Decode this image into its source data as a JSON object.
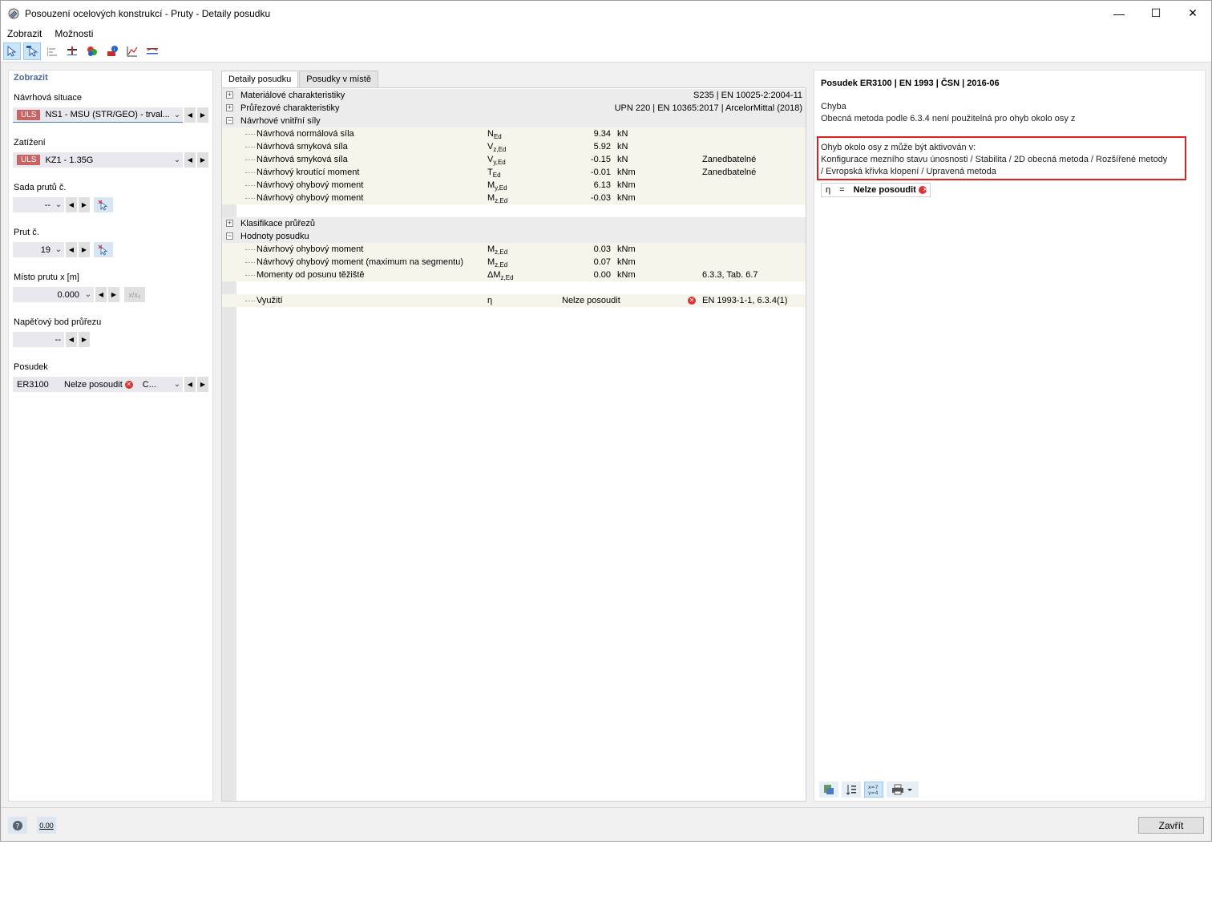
{
  "window": {
    "title": "Posouzení ocelových konstrukcí - Pruty - Detaily posudku",
    "minimize": "—",
    "maximize": "☐",
    "close": "✕"
  },
  "menu": [
    "Zobrazit",
    "Možnosti"
  ],
  "left": {
    "header": "Zobrazit",
    "design_situation_label": "Návrhová situace",
    "design_situation_tag": "ULS",
    "design_situation_value": "NS1 - MSÚ (STR/GEO) - trval...",
    "loading_label": "Zatížení",
    "loading_tag": "ULS",
    "loading_value": "KZ1 - 1.35G",
    "member_set_label": "Sada prutů č.",
    "member_set_value": "--",
    "member_label": "Prut č.",
    "member_value": "19",
    "location_label": "Místo prutu x [m]",
    "location_value": "0.000",
    "location_rel": "x/x₀",
    "stress_point_label": "Napěťový bod průřezu",
    "stress_point_value": "--",
    "check_label": "Posudek",
    "check_id": "ER3100",
    "check_status": "Nelze posoudit",
    "check_extra": "C..."
  },
  "tabs": [
    "Detaily posudku",
    "Posudky v místě"
  ],
  "sections": {
    "material": {
      "label": "Materiálové charakteristiky",
      "value": "S235 | EN 10025-2:2004-11"
    },
    "section": {
      "label": "Průřezové charakteristiky",
      "value": "UPN 220 | EN 10365:2017 | ArcelorMittal (2018)"
    },
    "forces": {
      "label": "Návrhové vnitřní síly"
    },
    "classification": {
      "label": "Klasifikace průřezů"
    },
    "check_values": {
      "label": "Hodnoty posudku"
    }
  },
  "force_rows": [
    {
      "name": "Návrhová normálová síla",
      "sym": "N",
      "sub": "Ed",
      "value": "9.34",
      "unit": "kN",
      "note": ""
    },
    {
      "name": "Návrhová smyková síla",
      "sym": "V",
      "sub": "z,Ed",
      "value": "5.92",
      "unit": "kN",
      "note": ""
    },
    {
      "name": "Návrhová smyková síla",
      "sym": "V",
      "sub": "y,Ed",
      "value": "-0.15",
      "unit": "kN",
      "note": "Zanedbatelné"
    },
    {
      "name": "Návrhový kroutící moment",
      "sym": "T",
      "sub": "Ed",
      "value": "-0.01",
      "unit": "kNm",
      "note": "Zanedbatelné"
    },
    {
      "name": "Návrhový ohybový moment",
      "sym": "M",
      "sub": "y,Ed",
      "value": "6.13",
      "unit": "kNm",
      "note": ""
    },
    {
      "name": "Návrhový ohybový moment",
      "sym": "M",
      "sub": "z,Ed",
      "value": "-0.03",
      "unit": "kNm",
      "note": ""
    }
  ],
  "check_rows": [
    {
      "name": "Návrhový ohybový moment",
      "sym": "M",
      "sub": "z,Ed",
      "value": "0.03",
      "unit": "kNm",
      "note": ""
    },
    {
      "name": "Návrhový ohybový moment (maximum na segmentu)",
      "sym": "M",
      "sub": "z,Ed",
      "value": "0.07",
      "unit": "kNm",
      "note": ""
    },
    {
      "name": "Momenty od posunu těžiště",
      "sym": "ΔM",
      "sub": "z,Ed",
      "value": "0.00",
      "unit": "kNm",
      "note": "6.3.3, Tab. 6.7"
    }
  ],
  "utilization": {
    "name": "Využití",
    "sym": "η",
    "value": "Nelze posoudit",
    "note": "EN 1993-1-1, 6.3.4(1)"
  },
  "right": {
    "title": "Posudek ER3100 | EN 1993 | ČSN | 2016-06",
    "error_label": "Chyba",
    "error_text": "Obecná metoda podle 6.3.4 není použitelná pro ohyb okolo osy z",
    "hint_line1": "Ohyb okolo osy z může být aktivován v:",
    "hint_line2": "Konfigurace mezního stavu únosnosti / Stabilita / 2D obecná metoda / Rozšířené metody",
    "hint_line3": "/ Evropská křivka klopení / Upravená metoda",
    "result_sym": "η",
    "result_eq": "=",
    "result_value": "Nelze posoudit"
  },
  "footer": {
    "close_label": "Zavřít",
    "units_label": "0.00"
  },
  "colors": {
    "uls_tag": "#c86464",
    "error": "#e03030",
    "highlight_box": "#e02020"
  }
}
